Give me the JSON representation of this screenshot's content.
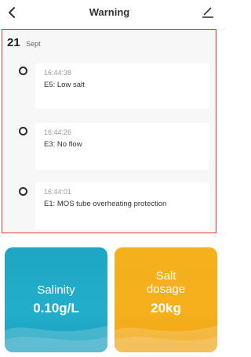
{
  "header": {
    "title": "Warning",
    "back_icon": "chevron-left-icon",
    "edit_icon": "edit-pencil-icon"
  },
  "warnings": {
    "day": "21",
    "month": "Sept",
    "items": [
      {
        "time": "16:44:38",
        "message": "E5:  Low salt"
      },
      {
        "time": "16:44:26",
        "message": "E3:  No flow"
      },
      {
        "time": "16:44:01",
        "message": "E1:   MOS tube overheating protection"
      }
    ]
  },
  "tiles": {
    "salinity": {
      "label": "Salinity",
      "value": "0.10g/L",
      "color": "#22aecb"
    },
    "dosage": {
      "label_line1": "Salt",
      "label_line2": "dosage",
      "value": "20kg",
      "color": "#f6b01d"
    }
  },
  "colors": {
    "highlight_border": "#e53935"
  }
}
